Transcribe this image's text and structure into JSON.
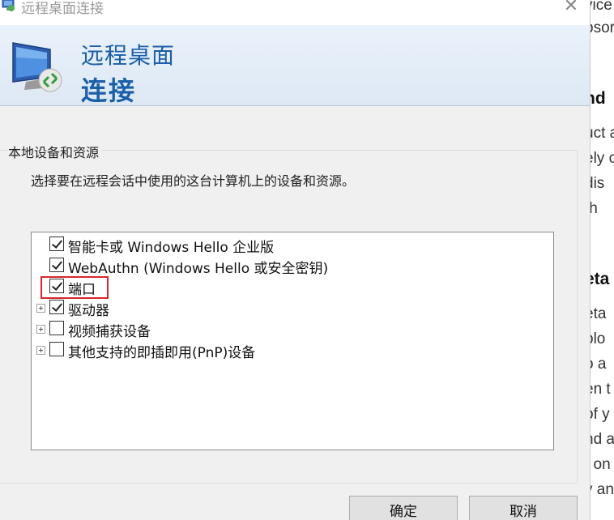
{
  "window": {
    "title": "远程桌面连接",
    "close_glyph": "✕"
  },
  "banner": {
    "line1": "远程桌面",
    "line2": "连接",
    "icon": "remote-desktop-monitor-icon"
  },
  "section": {
    "label": "本地设备和资源",
    "description": "选择要在远程会话中使用的这台计算机上的设备和资源。"
  },
  "tree_items": [
    {
      "label": "智能卡或 Windows Hello 企业版",
      "checked": true,
      "expandable": false
    },
    {
      "label": "WebAuthn (Windows Hello 或安全密钥)",
      "checked": true,
      "expandable": false
    },
    {
      "label": "端口",
      "checked": true,
      "expandable": false,
      "highlighted": true
    },
    {
      "label": "驱动器",
      "checked": true,
      "expandable": true
    },
    {
      "label": "视频捕获设备",
      "checked": false,
      "expandable": true
    },
    {
      "label": "其他支持的即插即用(PnP)设备",
      "checked": false,
      "expandable": true
    }
  ],
  "buttons": {
    "ok": "确定",
    "cancel": "取消"
  },
  "background_doc": {
    "lines": [
      "vice",
      "bsor",
      "nd",
      "uct a",
      "ely c",
      "dis",
      "th",
      "eta",
      "eta",
      "blo",
      "o a",
      "en t",
      "of y",
      "nd a",
      "t on",
      "y an"
    ]
  }
}
